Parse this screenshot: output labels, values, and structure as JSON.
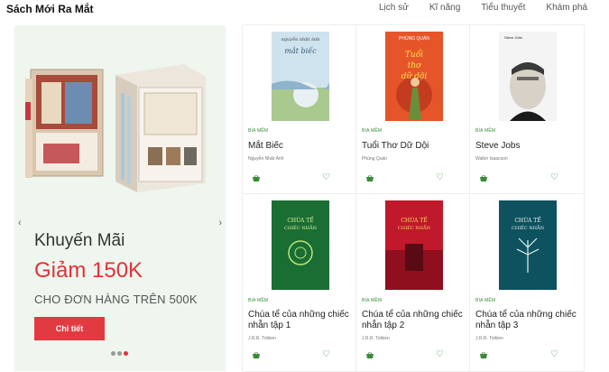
{
  "header": {
    "brand": "Sách Mới Ra Mắt",
    "nav": [
      "Lịch sử",
      "Kĩ năng",
      "Tiểu thuyết",
      "Khám phá"
    ]
  },
  "promo": {
    "heading": "Khuyến Mãi",
    "discount": "Giảm 150K",
    "subtitle": "CHO ĐƠN HÀNG TRÊN 500K",
    "button": "Chi tiết",
    "arrow_left": "‹",
    "arrow_right": "›",
    "slides": 3,
    "active_slide": 3
  },
  "books": [
    {
      "category": "BÌA MỀM",
      "title": "Mắt Biếc",
      "author": "Nguyễn Nhật Ánh",
      "cover_top": "nguyễn nhật ánh",
      "cover_title": "mắt biếc"
    },
    {
      "category": "BÌA MỀM",
      "title": "Tuổi Thơ Dữ Dội",
      "author": "Phùng Quán",
      "cover_top": "PHÙNG QUÁN",
      "cover_title": "Tuổi thơ dữ dội"
    },
    {
      "category": "BÌA MỀM",
      "title": "Steve Jobs",
      "author": "Walter Isaacson",
      "cover_top": "Steve Jobs"
    },
    {
      "category": "BÌA MỀM",
      "title": "Chúa tể của những chiếc nhẫn tập 1",
      "author": "J.R.R. Tolkien",
      "cover_title": "CHÚA TỂ CHIẾC NHẪN"
    },
    {
      "category": "BÌA MỀM",
      "title": "Chúa tể của những chiếc nhẫn tập 2",
      "author": "J.R.R. Tolkien",
      "cover_title": "CHÚA TỂ CHIẾC NHẪN"
    },
    {
      "category": "BÌA MỀM",
      "title": "Chúa tể của những chiếc nhẫn tập 3",
      "author": "J.R.R. Tolkien",
      "cover_title": "CHÚA TỂ CHIẾC NHẪN"
    }
  ],
  "icons": {
    "cart": "shopping-basket-icon",
    "wishlist": "heart-outline-icon"
  },
  "colors": {
    "accent": "#e2323a",
    "green": "#3a8a3a",
    "promo_bg": "#eef6ee"
  }
}
